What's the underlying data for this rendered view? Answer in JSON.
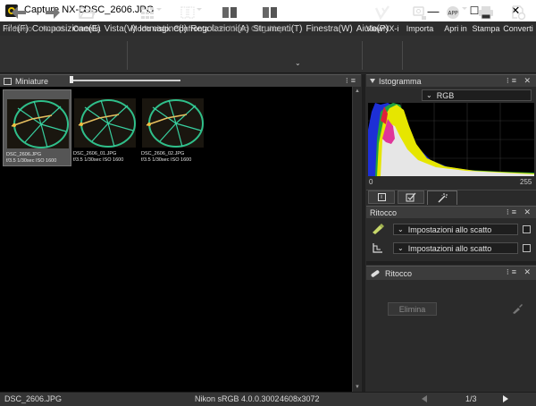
{
  "window": {
    "app_name": "Capture NX-D",
    "file_name": "DSC_2606.JPG",
    "controls": {
      "minimize": "—",
      "maximize": "☐",
      "close": "✕"
    }
  },
  "menu": [
    "File(F)",
    "Composizione(E)",
    "Vista(V)",
    "Immagine(I)",
    "Regolazioni(A)",
    "Strumenti(T)",
    "Finestra(W)",
    "Aiuto(P)"
  ],
  "toolbar": {
    "back": "Indietro",
    "forward": "Avanti",
    "folder": "Cartella",
    "view_mode": "Modo visio.",
    "compare": "Confronta",
    "before_after": "Corr./dopo",
    "orig_after": "Orig./dopo",
    "viewnx": "ViewNX-i",
    "import": "Importa",
    "open_in": "Apri in",
    "print": "Stampa",
    "convert": "Converti"
  },
  "thumbnails_panel": {
    "title": "Miniature",
    "items": [
      {
        "name": "DSC_2606.JPG",
        "info": "f/3.5 1/30sec ISO 1600",
        "selected": true
      },
      {
        "name": "DSC_2606_01.JPG",
        "info": "f/3.5 1/30sec ISO 1600",
        "selected": false
      },
      {
        "name": "DSC_2606_02.JPG",
        "info": "f/3.5 1/30sec ISO 1600",
        "selected": false
      }
    ]
  },
  "histogram_panel": {
    "title": "Istogramma",
    "channel": "RGB",
    "axis_min": "0",
    "axis_max": "255"
  },
  "adjust_panel": {
    "title": "Ritocco",
    "rows": [
      {
        "value": "Impostazioni allo scatto",
        "icon": "picture-control-icon"
      },
      {
        "value": "Impostazioni allo scatto",
        "icon": "tone-curve-icon"
      }
    ]
  },
  "retouch_panel": {
    "title": "Ritocco",
    "delete_button": "Elimina"
  },
  "status": {
    "file": "DSC_2606.JPG",
    "color_profile": "Nikon sRGB 4.0.0.3002",
    "dimensions": "4608x3072",
    "page": "1/3"
  },
  "colors": {
    "background": "#000000",
    "panel": "#2b2b2b",
    "selection": "#555555",
    "hist_red": "#e0203a",
    "hist_green": "#20a040",
    "hist_blue": "#2030d0",
    "hist_yellow": "#e6e600"
  }
}
